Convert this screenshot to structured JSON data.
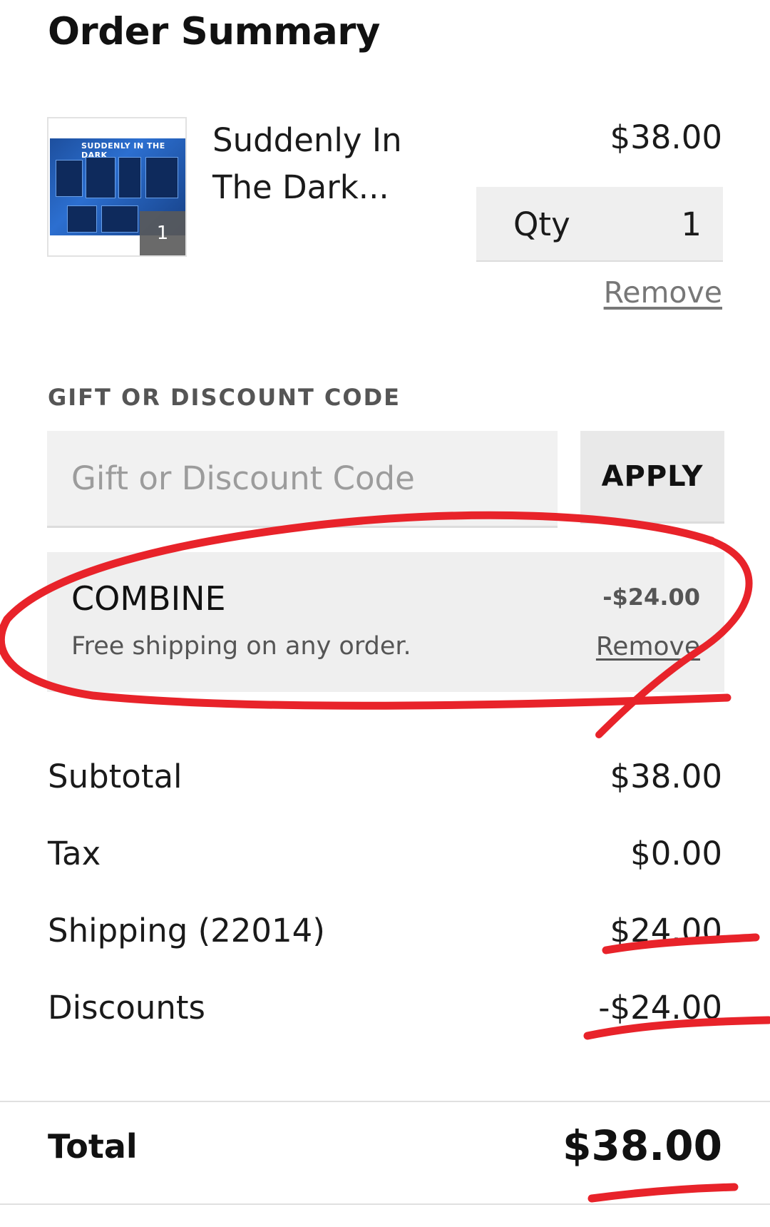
{
  "page": {
    "title": "Order Summary"
  },
  "cart_item": {
    "name_line1": "Suddenly In",
    "name_line2": "The Dark...",
    "price": "$38.00",
    "qty_label": "Qty",
    "qty_value": "1",
    "thumbnail_badge": "1",
    "thumbnail_text": "SUDDENLY IN THE DARK",
    "remove_label": "Remove"
  },
  "discount": {
    "section_label": "GIFT OR DISCOUNT CODE",
    "input_placeholder": "Gift or Discount Code",
    "apply_label": "APPLY",
    "applied": {
      "code": "COMBINE",
      "description": "Free shipping on any order.",
      "amount": "-$24.00",
      "remove_label": "Remove"
    }
  },
  "totals": {
    "rows": [
      {
        "label": "Subtotal",
        "value": "$38.00"
      },
      {
        "label": "Tax",
        "value": "$0.00"
      },
      {
        "label": "Shipping (22014)",
        "value": "$24.00"
      },
      {
        "label": "Discounts",
        "value": "-$24.00"
      }
    ],
    "total_label": "Total",
    "total_value": "$38.00"
  },
  "colors": {
    "annotation_red": "#e8232a",
    "panel_gray": "#efefef"
  }
}
